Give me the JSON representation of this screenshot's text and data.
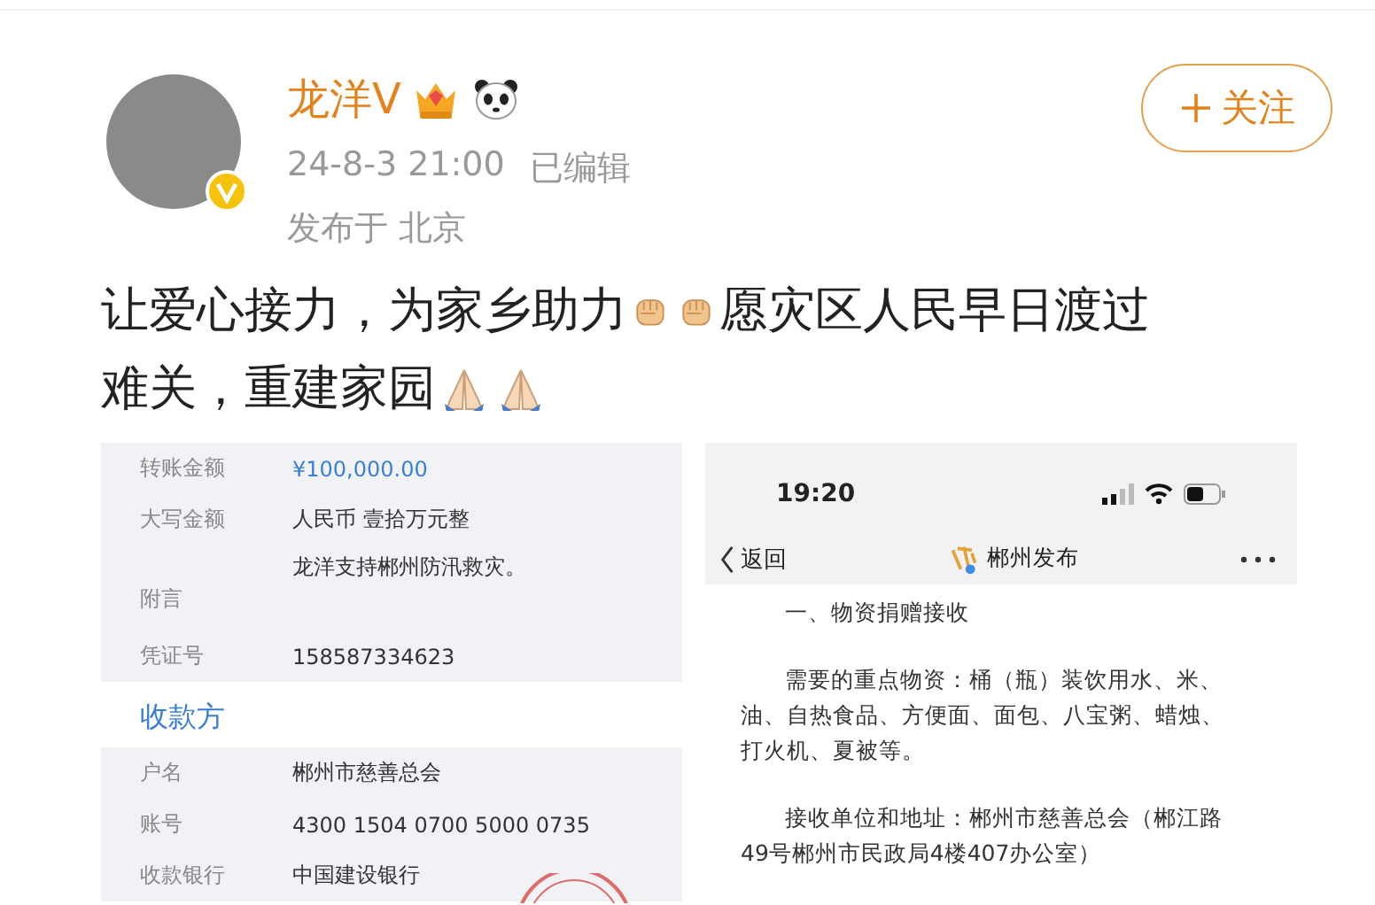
{
  "post": {
    "author": {
      "name": "龙洋V",
      "verified": true
    },
    "follow_button": {
      "label": "关注"
    },
    "timestamp": "24-8-3 21:00",
    "edited": "已编辑",
    "location": "发布于 北京",
    "text_lines": [
      [
        {
          "kind": "text",
          "text": "让爱心接力，为家乡助力"
        },
        {
          "kind": "fist"
        },
        {
          "kind": "fist"
        },
        {
          "kind": "text",
          "text": "愿灾区人民早日渡过"
        }
      ],
      [
        {
          "kind": "text",
          "text": "难关，重建家园"
        },
        {
          "kind": "pray"
        },
        {
          "kind": "pray"
        }
      ]
    ]
  },
  "receipt": {
    "rows": [
      {
        "label": "转账金额",
        "value": "¥100,000.00",
        "kind": "amount"
      },
      {
        "label": "大写金额",
        "value": "人民币 壹拾万元整",
        "kind": "plain"
      },
      {
        "label": "附言",
        "value": "龙洋支持郴州防汛救灾。",
        "kind": "note"
      },
      {
        "label": "凭证号",
        "value": "158587334623",
        "kind": "plain"
      }
    ],
    "payee_heading": "收款方",
    "payee_rows": [
      {
        "label": "户名",
        "value": "郴州市慈善总会",
        "kind": "plain"
      },
      {
        "label": "账号",
        "value": "4300 1504 0700 5000 0735",
        "kind": "plain"
      },
      {
        "label": "收款银行",
        "value": "中国建设银行",
        "kind": "plain"
      }
    ]
  },
  "phone": {
    "time": "19:20",
    "back": "返回",
    "title": "郴州发布",
    "paragraphs": [
      "一、物资捐赠接收",
      "需要的重点物资：桶（瓶）装饮用水、米、油、自热食品、方便面、面包、八宝粥、蜡烛、打火机、夏被等。",
      "接收单位和地址：郴州市慈善总会（郴江路49号郴州市民政局4楼407办公室）"
    ]
  }
}
